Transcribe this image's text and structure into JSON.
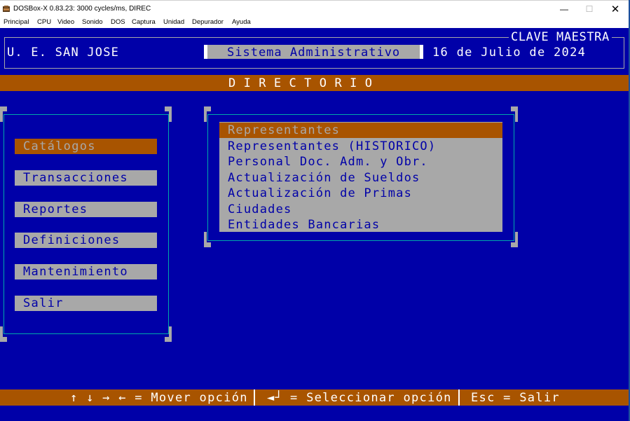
{
  "window": {
    "title": "DOSBox-X 0.83.23: 3000 cycles/ms, DIREC",
    "minimize_glyph": "—",
    "maximize_glyph": "☐",
    "close_glyph": "✕"
  },
  "menubar": {
    "items": [
      "Principal",
      "CPU",
      "Video",
      "Sonido",
      "DOS",
      "Captura",
      "Unidad",
      "Depurador",
      "Ayuda"
    ]
  },
  "header": {
    "school": "U. E. SAN JOSE",
    "system": "Sistema Administrativo",
    "date": "16 de Julio de 2024",
    "mode": "CLAVE MAESTRA"
  },
  "title_bar": {
    "label": "DIRECTORIO"
  },
  "main_menu": {
    "items": [
      {
        "label": "Catálogos",
        "selected": true
      },
      {
        "label": "Transacciones",
        "selected": false
      },
      {
        "label": "Reportes",
        "selected": false
      },
      {
        "label": "Definiciones",
        "selected": false
      },
      {
        "label": "Mantenimiento",
        "selected": false
      },
      {
        "label": "Salir",
        "selected": false
      }
    ]
  },
  "submenu": {
    "items": [
      {
        "label": "Representantes",
        "selected": true
      },
      {
        "label": "Representantes (HISTORICO)",
        "selected": false
      },
      {
        "label": "Personal Doc. Adm. y Obr.",
        "selected": false
      },
      {
        "label": "Actualización de Sueldos",
        "selected": false
      },
      {
        "label": "Actualización de Primas",
        "selected": false
      },
      {
        "label": "Ciudades",
        "selected": false
      },
      {
        "label": "Entidades Bancarias",
        "selected": false
      }
    ]
  },
  "status_bar": {
    "move": "↑ ↓ → ← = Mover opción",
    "select_key": "◄┘",
    "select": "= Seleccionar opción",
    "exit": "Esc = Salir"
  },
  "colors": {
    "dos_blue": "#0000a8",
    "dos_orange": "#a85400",
    "dos_gray": "#a8a8a8",
    "dos_cyan": "#00a8a8"
  },
  "icons": {
    "app": "dosbox-icon"
  }
}
